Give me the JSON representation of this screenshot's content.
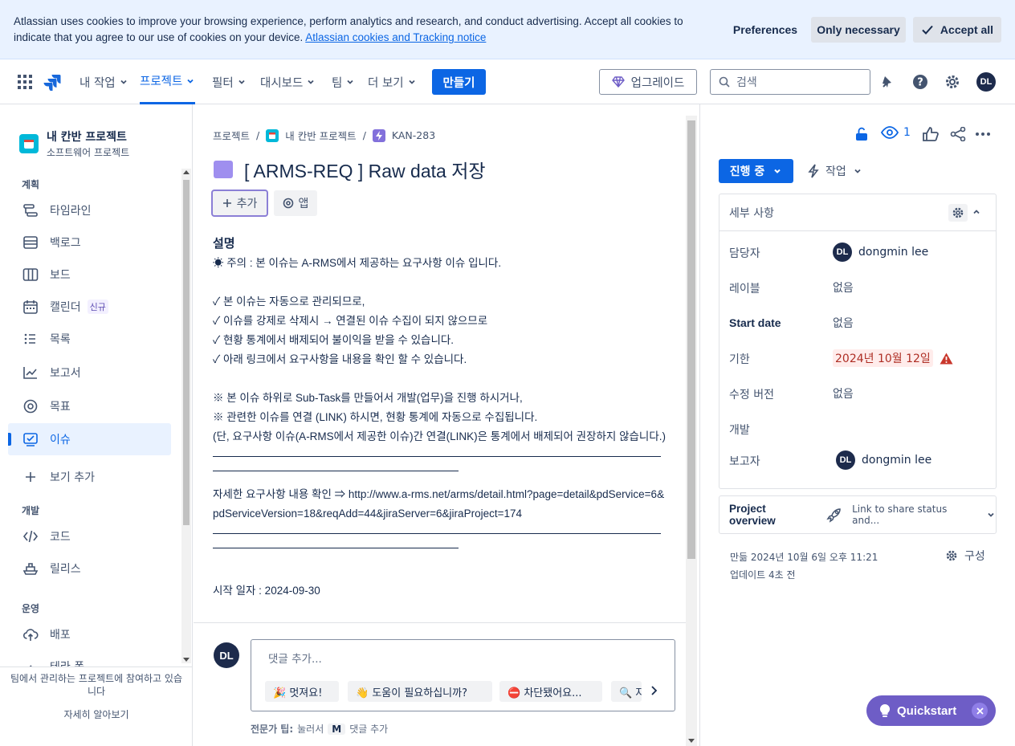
{
  "cookie": {
    "text": "Atlassian uses cookies to improve your browsing experience, perform analytics and research, and conduct advertising. Accept all cookies to indicate that you agree to our use of cookies on your device.",
    "link": "Atlassian cookies and Tracking notice",
    "preferences": "Preferences",
    "only_necessary": "Only necessary",
    "accept_all": "Accept all"
  },
  "nav": {
    "items": [
      "내 작업",
      "프로젝트",
      "필터",
      "대시보드",
      "팀",
      "더 보기"
    ],
    "create": "만들기",
    "upgrade": "업그레이드",
    "search_placeholder": "검색",
    "avatar": "DL"
  },
  "sidebar": {
    "project_name": "내 칸반 프로젝트",
    "project_type": "소프트웨어 프로젝트",
    "sections": {
      "plan": "계획",
      "dev": "개발",
      "ops": "운영"
    },
    "items": [
      "타임라인",
      "백로그",
      "보드",
      "캘린더",
      "목록",
      "보고서",
      "목표",
      "이슈",
      "보기 추가",
      "코드",
      "릴리스",
      "배포"
    ],
    "new_badge": "신규",
    "partial_item": "테라 폼",
    "footer_text": "팀에서 관리하는 프로젝트에 참여하고 있습니다",
    "footer_link": "자세히 알아보기"
  },
  "issue": {
    "breadcrumb": [
      "프로젝트",
      "내 칸반 프로젝트",
      "KAN-283"
    ],
    "title": "[ ARMS-REQ ] Raw data 저장",
    "add": "추가",
    "apps": "앱",
    "desc_title": "설명",
    "lines": [
      "☀ 주의 : 본 이슈는 A-RMS에서 제공하는 요구사항 이슈 입니다.",
      "",
      "✓ 본 이슈는 자동으로 관리되므로,",
      "✓ 이슈를 강제로 삭제시 → 연결된 이슈 수집이 되지 않으므로",
      "✓ 현황 통계에서 배제되어 불이익을 받을 수 있습니다.",
      "✓ 아래 링크에서 요구사항을 내용을 확인 할 수 있습니다.",
      "",
      "※ 본 이슈 하위로 Sub-Task를 만들어서 개발(업무)을 진행 하시거나,",
      "※ 관련한 이슈를 연결 (LINK) 하시면, 현황 통계에 자동으로 수집됩니다.",
      "(단, 요구사항 이슈(A-RMS에서 제공한 이슈)간 연결(LINK)은 통계에서 배제되어 권장하지 않습니다.)"
    ],
    "link_line": "자세한 요구사항 내용 확인 ⇒ http://www.a-rms.net/arms/detail.html?page=detail&pdService=6&pdServiceVersion=18&reqAdd=44&jiraServer=6&jiraProject=174",
    "cut_line": "시작 일자 : 2024-09-30"
  },
  "comment": {
    "avatar": "DL",
    "placeholder": "댓글 추가...",
    "chips": [
      "🎉 멋져요!",
      "👋 도움이 필요하십니까?",
      "⛔ 차단됐어요...",
      "🔍 자세히"
    ],
    "tip_bold": "전문가 팁:",
    "tip_pre": "눌러서",
    "tip_key": "M",
    "tip_post": "댓글 추가"
  },
  "panel": {
    "watch_count": "1",
    "status": "진행 중",
    "action": "작업",
    "details_title": "세부 사항",
    "fields": [
      {
        "label": "담당자",
        "value": "dongmin lee",
        "avatar": "DL"
      },
      {
        "label": "레이블",
        "value": "없음"
      },
      {
        "label": "Start date",
        "value": "없음"
      },
      {
        "label": "기한",
        "value": "2024년 10월 12일"
      },
      {
        "label": "수정 버전",
        "value": "없음"
      },
      {
        "label": "개발",
        "value": ""
      },
      {
        "label": "보고자",
        "value": "dongmin lee",
        "avatar": "DL"
      }
    ],
    "overview_title": "Project overview",
    "overview_link": "Link to share status and...",
    "created": "만듦 2024년 10월 6일 오후 11:21",
    "updated": "업데이트 4초 전",
    "configure": "구성"
  },
  "quickstart": {
    "label": "Quickstart"
  },
  "colors": {
    "primary": "#0c66e4",
    "due_bg": "#ffeceb",
    "due_text": "#ae2e24",
    "danger": "#c9372c",
    "quickstart": "#6e5dc6"
  }
}
